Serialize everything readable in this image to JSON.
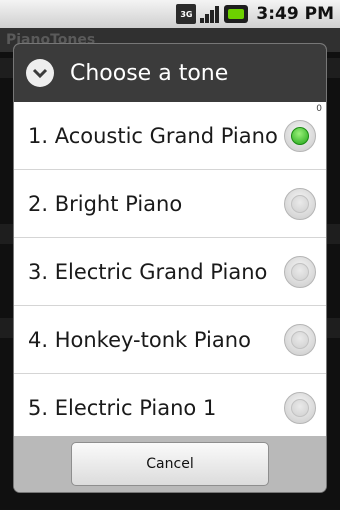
{
  "status_bar": {
    "network": "3G",
    "time": "3:49 PM"
  },
  "app": {
    "title": "PianoTones"
  },
  "dialog": {
    "title": "Choose a tone",
    "scroll_marker": "0",
    "items": [
      {
        "label": "1. Acoustic Grand Piano",
        "selected": true
      },
      {
        "label": "2. Bright Piano",
        "selected": false
      },
      {
        "label": "3. Electric Grand Piano",
        "selected": false
      },
      {
        "label": "4. Honkey-tonk Piano",
        "selected": false
      },
      {
        "label": "5. Electric Piano 1",
        "selected": false
      }
    ],
    "cancel_label": "Cancel"
  },
  "colors": {
    "header_bg": "#3b3b3b",
    "selected_radio": "#1fa516",
    "footer_bg": "#b9b9b9"
  }
}
